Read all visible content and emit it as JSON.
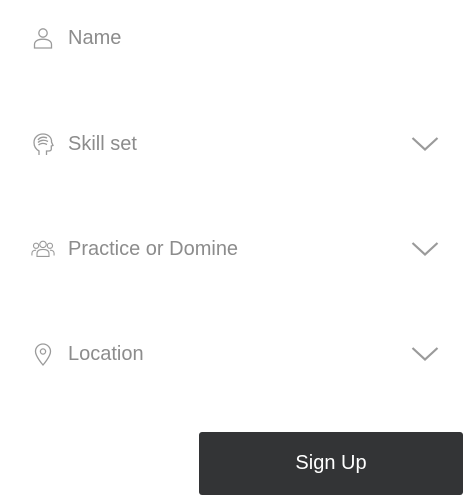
{
  "form": {
    "fields": [
      {
        "label": "Name",
        "icon": "user-icon",
        "type": "text"
      },
      {
        "label": "Skill set",
        "icon": "head-icon",
        "type": "dropdown"
      },
      {
        "label": "Practice or Domine",
        "icon": "group-icon",
        "type": "dropdown"
      },
      {
        "label": "Location",
        "icon": "location-pin-icon",
        "type": "dropdown"
      }
    ],
    "submit_label": "Sign Up"
  },
  "colors": {
    "text_muted": "#8c8c8c",
    "icon_stroke": "#9a9a9a",
    "button_bg": "#333436",
    "button_text": "#ffffff"
  }
}
